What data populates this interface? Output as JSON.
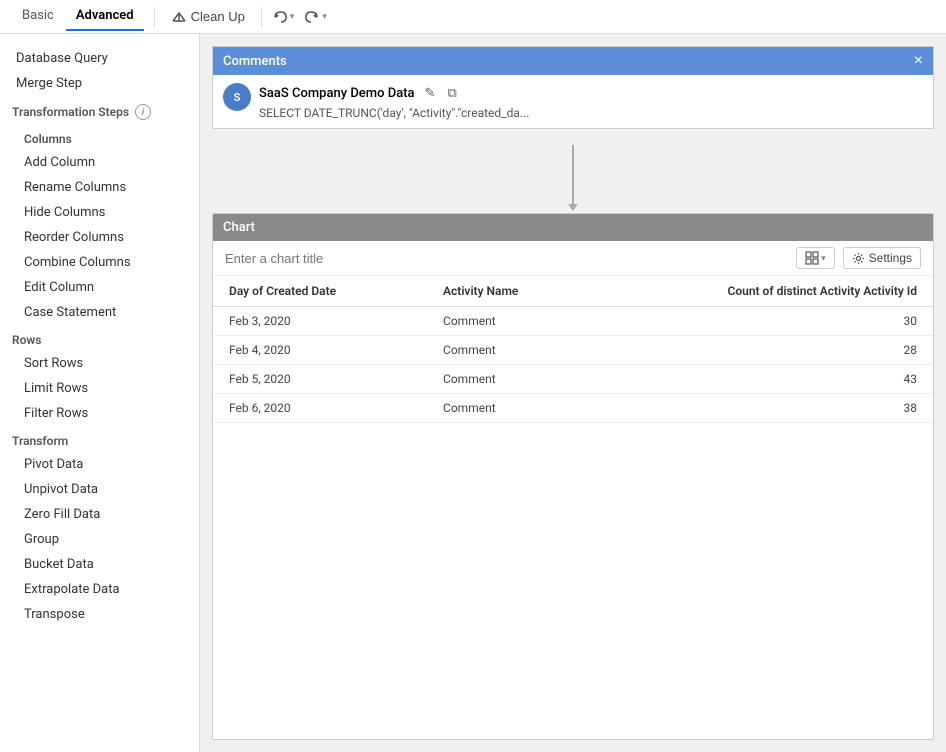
{
  "toolbar": {
    "tab_basic": "Basic",
    "tab_advanced": "Advanced",
    "btn_cleanup": "Clean Up",
    "btn_undo": "↩",
    "btn_redo": "↪"
  },
  "sidebar": {
    "section_database": "Database Query",
    "section_merge": "Merge Step",
    "section_transformation": "Transformation Steps",
    "section_columns": "Columns",
    "items_columns": [
      "Add Column",
      "Rename Columns",
      "Hide Columns",
      "Reorder Columns",
      "Combine Columns",
      "Edit Column",
      "Case Statement"
    ],
    "section_rows": "Rows",
    "items_rows": [
      "Sort Rows",
      "Limit Rows",
      "Filter Rows"
    ],
    "section_transform": "Transform",
    "items_transform": [
      "Pivot Data",
      "Unpivot Data",
      "Zero Fill Data",
      "Group",
      "Bucket Data",
      "Extrapolate Data",
      "Transpose"
    ]
  },
  "comments": {
    "title": "Comments",
    "close_label": "×",
    "author": "SaaS Company Demo Data",
    "avatar_initials": "S",
    "sql_preview": "SELECT DATE_TRUNC('day', \"Activity\".\"created_da...",
    "edit_icon": "✎",
    "copy_icon": "⧉"
  },
  "chart": {
    "header": "Chart",
    "title_placeholder": "Enter a chart title",
    "settings_label": "Settings",
    "columns": [
      "Day of Created Date",
      "Activity Name",
      "Count of distinct Activity Activity Id"
    ],
    "rows": [
      {
        "date": "Feb 3, 2020",
        "activity": "Comment",
        "count": "30"
      },
      {
        "date": "Feb 4, 2020",
        "activity": "Comment",
        "count": "28"
      },
      {
        "date": "Feb 5, 2020",
        "activity": "Comment",
        "count": "43"
      },
      {
        "date": "Feb 6, 2020",
        "activity": "Comment",
        "count": "38"
      }
    ]
  }
}
